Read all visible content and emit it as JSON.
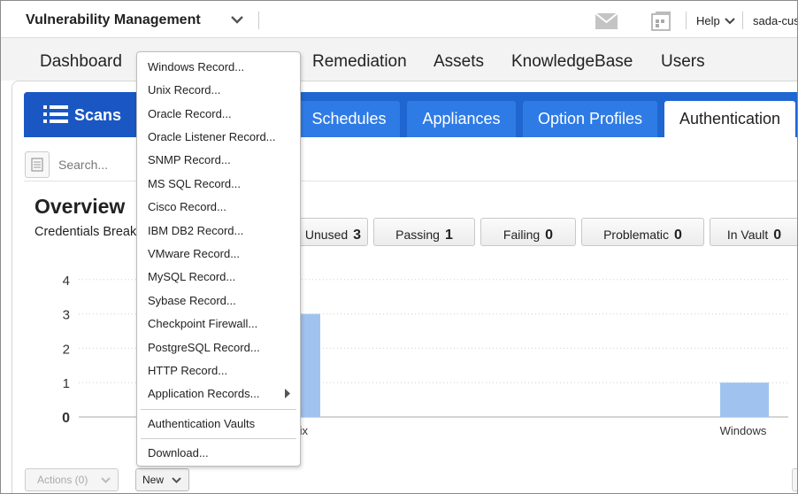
{
  "header": {
    "app_title": "Vulnerability Management",
    "help_label": "Help",
    "user_label": "sada-cus"
  },
  "nav": {
    "items": [
      "Dashboard",
      "Remediation",
      "Assets",
      "KnowledgeBase",
      "Users"
    ]
  },
  "tabs": {
    "scans_label": "Scans",
    "items": [
      "Schedules",
      "Appliances",
      "Option Profiles",
      "Authentication"
    ],
    "active": "Authentication"
  },
  "search": {
    "placeholder": "Search..."
  },
  "overview": {
    "title": "Overview",
    "subtitle": "Credentials Breakdown"
  },
  "stats": [
    {
      "label": "Unused",
      "value": "3"
    },
    {
      "label": "Passing",
      "value": "1"
    },
    {
      "label": "Failing",
      "value": "0"
    },
    {
      "label": "Problematic",
      "value": "0"
    },
    {
      "label": "In Vault",
      "value": "0"
    }
  ],
  "chart_data": {
    "type": "bar",
    "categories": [
      "Unix",
      "Windows"
    ],
    "values": [
      3,
      1
    ],
    "y_ticks": [
      "0",
      "1",
      "2",
      "3",
      "4"
    ],
    "ylim": [
      0,
      4
    ],
    "grid": true,
    "bar_color": "#9fc3ee"
  },
  "bottom": {
    "actions_label": "Actions (0)",
    "new_label": "New"
  },
  "menu": {
    "items": [
      "Windows Record...",
      "Unix Record...",
      "Oracle Record...",
      "Oracle Listener Record...",
      "SNMP Record...",
      "MS SQL Record...",
      "Cisco Record...",
      "IBM DB2 Record...",
      "VMware Record...",
      "MySQL Record...",
      "Sybase Record...",
      "Checkpoint Firewall...",
      "PostgreSQL Record...",
      "HTTP Record...",
      "Application Records..."
    ],
    "vaults_label": "Authentication Vaults",
    "download_label": "Download..."
  },
  "colors": {
    "tab_blue": "#1f66d1",
    "subtab_blue": "#2f7be6",
    "bar": "#9fc3ee"
  },
  "icons": [
    "chevron-down-icon",
    "mail-icon",
    "calendar-icon",
    "list-icon",
    "submenu-arrow-icon"
  ]
}
